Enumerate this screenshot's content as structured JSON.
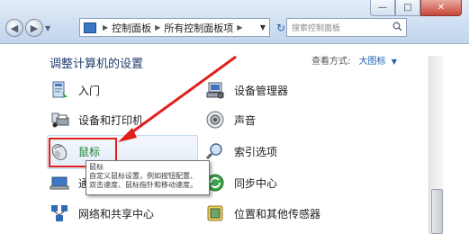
{
  "window": {
    "minimize_label": "—",
    "maximize_label": "□",
    "close_label": "✕"
  },
  "nav": {
    "back_label": "◀",
    "forward_label": "▶",
    "dropdown_label": "▼",
    "refresh_label": "↻"
  },
  "address_bar": {
    "crumbs": [
      "控制面板",
      "所有控制面板项"
    ],
    "separator": "▶",
    "dropdown": "▼"
  },
  "search": {
    "placeholder": "搜索控制面板",
    "icon": "magnifier-icon"
  },
  "page": {
    "heading": "调整计算机的设置",
    "view_by_label": "查看方式:",
    "view_by_value": "大图标",
    "view_by_arrow": "▼"
  },
  "items_left": [
    {
      "label": "入门",
      "icon": "getting-started-icon"
    },
    {
      "label": "设备和打印机",
      "icon": "printer-icon"
    },
    {
      "label": "鼠标",
      "icon": "mouse-icon"
    },
    {
      "label": "通",
      "icon": "sync-laptop-icon"
    },
    {
      "label": "网络和共享中心",
      "icon": "network-icon"
    }
  ],
  "items_right": [
    {
      "label": "设备管理器",
      "icon": "device-manager-icon"
    },
    {
      "label": "声音",
      "icon": "speaker-icon"
    },
    {
      "label": "索引选项",
      "icon": "index-magnifier-icon"
    },
    {
      "label": "同步中心",
      "icon": "sync-icon"
    },
    {
      "label": "位置和其他传感器",
      "icon": "sensor-icon"
    }
  ],
  "tooltip": {
    "title": "鼠标",
    "line1": "自定义鼠标设置，例如按钮配置、",
    "line2": "双击速度、鼠标指针和移动速度。"
  },
  "colors": {
    "annotation_red": "#e0201c",
    "link_green": "#1a7f2e",
    "heading_blue": "#1e3c6e"
  }
}
